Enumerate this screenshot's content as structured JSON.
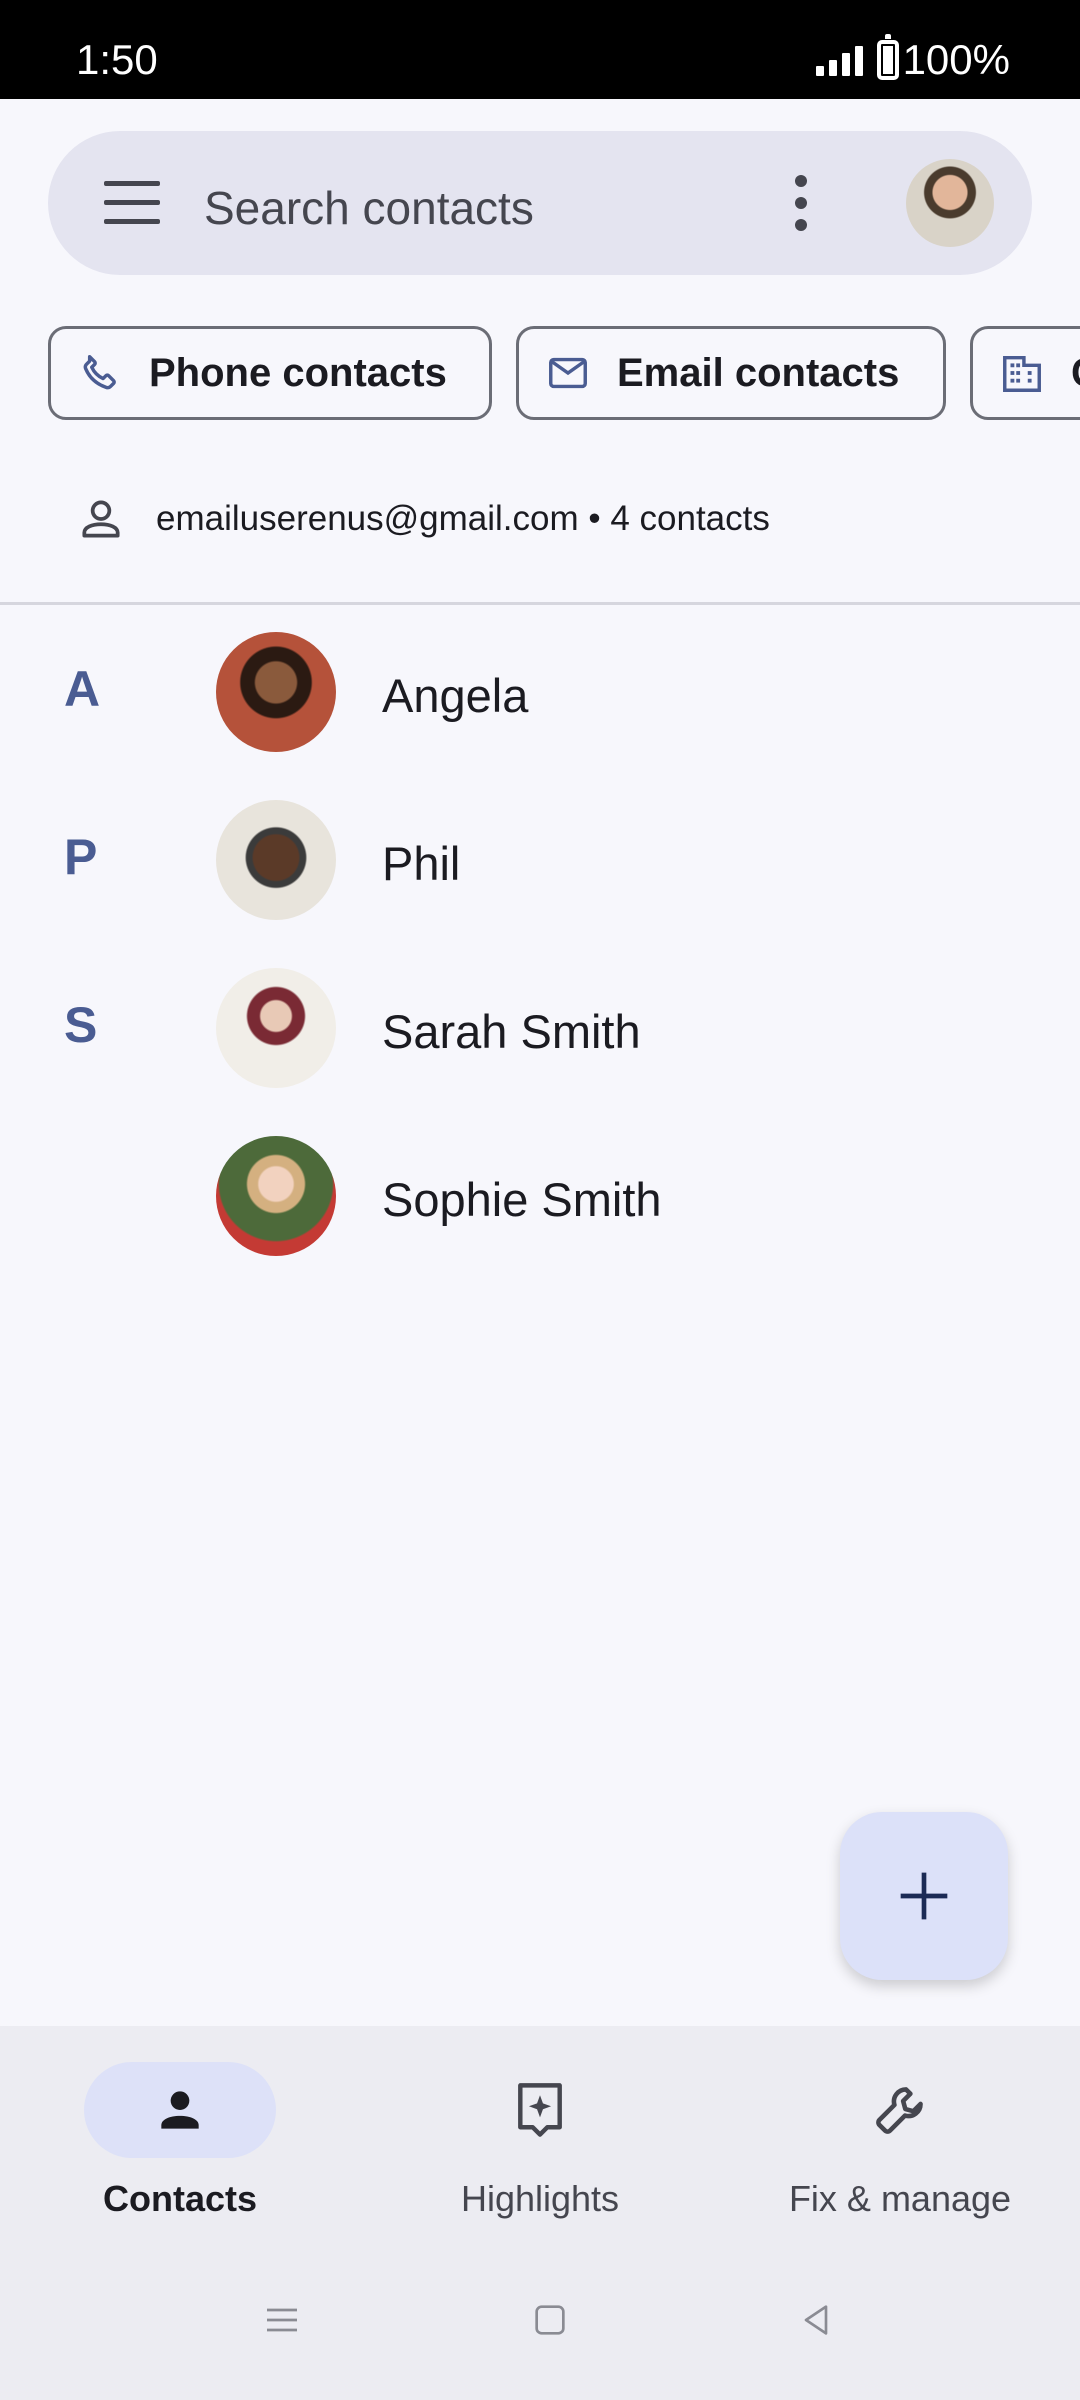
{
  "status_bar": {
    "time": "1:50",
    "battery": "100%"
  },
  "search": {
    "placeholder": "Search contacts"
  },
  "chips": [
    {
      "label": "Phone contacts",
      "icon": "phone-icon"
    },
    {
      "label": "Email contacts",
      "icon": "mail-icon"
    },
    {
      "label": "C",
      "icon": "building-icon"
    }
  ],
  "account": {
    "text": "emailuserenus@gmail.com • 4 contacts"
  },
  "contacts": [
    {
      "letter": "A",
      "name": "Angela"
    },
    {
      "letter": "P",
      "name": "Phil"
    },
    {
      "letter": "S",
      "name": "Sarah Smith"
    },
    {
      "letter": "",
      "name": "Sophie Smith"
    }
  ],
  "bottom_nav": {
    "items": [
      {
        "label": "Contacts",
        "icon": "person-icon",
        "active": true
      },
      {
        "label": "Highlights",
        "icon": "sparkle-icon",
        "active": false
      },
      {
        "label": "Fix & manage",
        "icon": "wrench-icon",
        "active": false
      }
    ]
  },
  "colors": {
    "accent": "#4a5c92",
    "background": "#f7f7fc",
    "fab": "#dce1f9"
  }
}
